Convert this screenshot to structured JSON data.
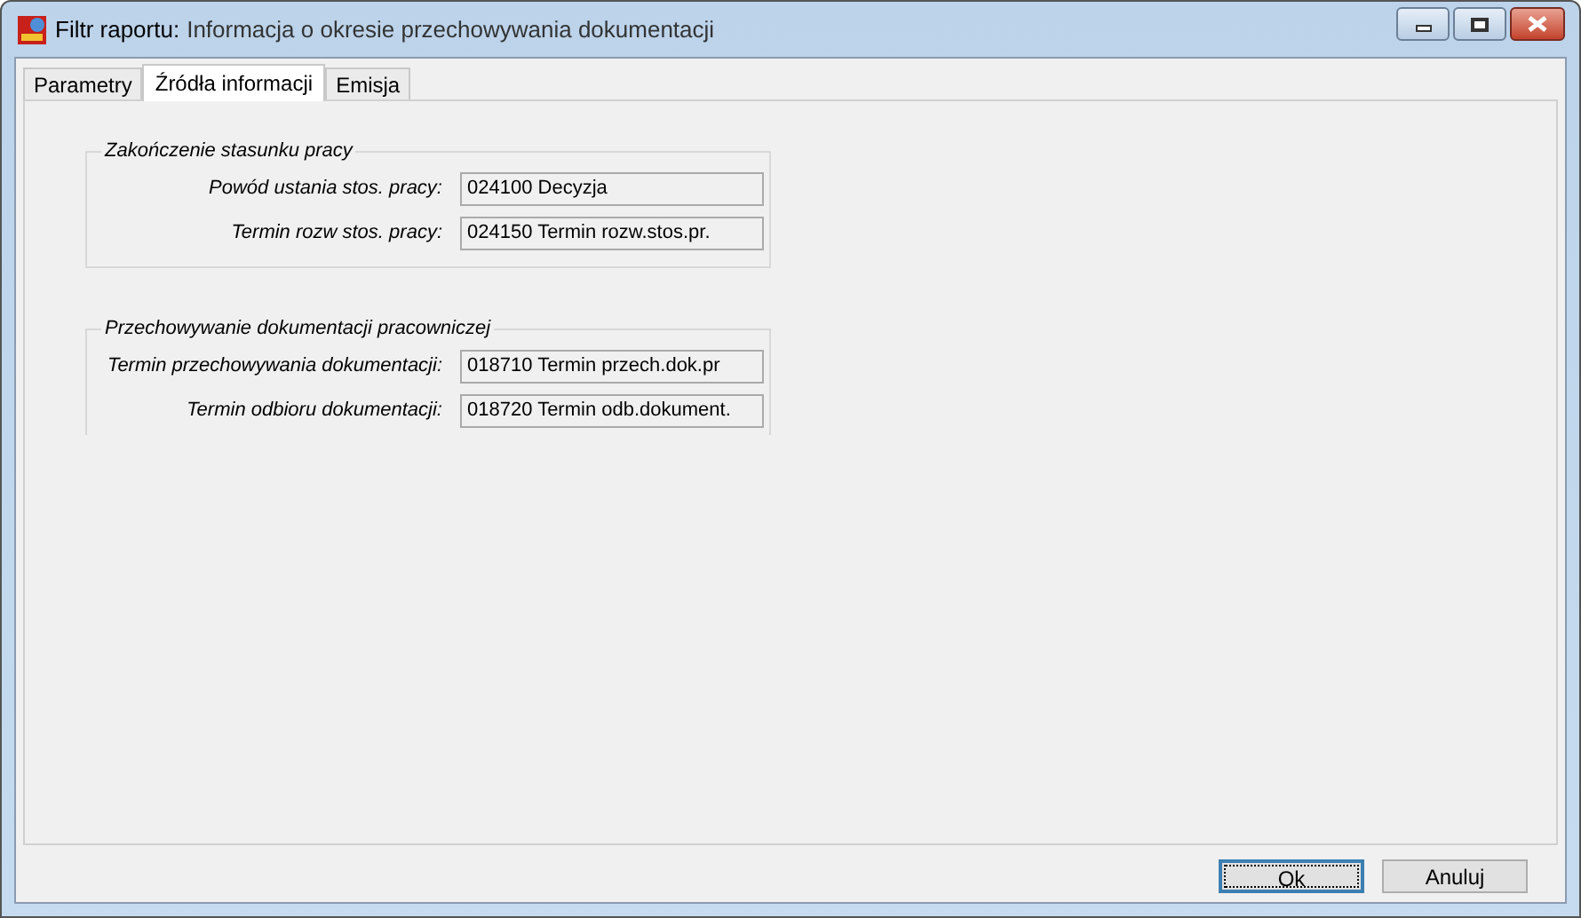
{
  "window": {
    "title_prefix": "Filtr raportu:",
    "title": "Informacja o okresie przechowywania dokumentacji"
  },
  "tabs": [
    {
      "label": "Parametry",
      "selected": false
    },
    {
      "label": "Źródła informacji",
      "selected": true
    },
    {
      "label": "Emisja",
      "selected": false
    }
  ],
  "groups": [
    {
      "title": "Zakończenie stasunku pracy",
      "closed": true,
      "fields": [
        {
          "label": "Powód ustania stos. pracy:",
          "value": "024100 Decyzja"
        },
        {
          "label": "Termin rozw stos. pracy:",
          "value": "024150 Termin rozw.stos.pr."
        }
      ]
    },
    {
      "title": "Przechowywanie dokumentacji pracowniczej",
      "closed": false,
      "fields": [
        {
          "label": "Termin przechowywania dokumentacji:",
          "value": "018710 Termin przech.dok.pr"
        },
        {
          "label": "Termin odbioru dokumentacji:",
          "value": "018720 Termin odb.dokument."
        }
      ]
    }
  ],
  "buttons": [
    {
      "label": "Ok",
      "focused": true
    },
    {
      "label": "Anuluj",
      "focused": false
    }
  ]
}
